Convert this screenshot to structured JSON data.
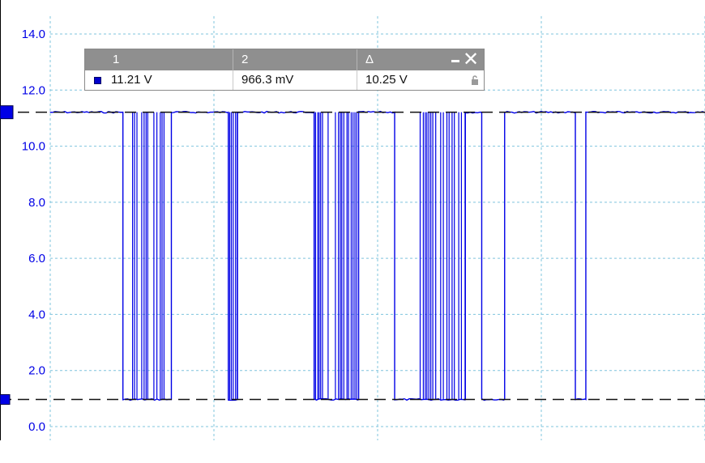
{
  "chart_data": {
    "type": "line",
    "title": "",
    "xlabel": "",
    "ylabel": "",
    "ylim": [
      0,
      14
    ],
    "y_ticks": [
      "0.0",
      "2.0",
      "4.0",
      "6.0",
      "8.0",
      "10.0",
      "12.0",
      "14.0"
    ],
    "y_tick_values": [
      0,
      2,
      4,
      6,
      8,
      10,
      12,
      14
    ],
    "grid": true,
    "series": [
      {
        "color": "#0000e6",
        "high_level": 11.21,
        "low_level": 0.966,
        "low_segments": [
          [
            0.111,
            0.185
          ],
          [
            0.272,
            0.286
          ],
          [
            0.403,
            0.471
          ],
          [
            0.526,
            0.634
          ],
          [
            0.659,
            0.694
          ],
          [
            0.802,
            0.818
          ]
        ],
        "dense_regions": [
          [
            0.122,
            0.182
          ],
          [
            0.272,
            0.286
          ],
          [
            0.403,
            0.471
          ],
          [
            0.565,
            0.634
          ]
        ]
      }
    ],
    "cursors": [
      {
        "label": "1",
        "value": 11.21
      },
      {
        "label": "2",
        "value": 0.966
      }
    ]
  },
  "colors": {
    "trace": "#0000e6",
    "tick_label": "#0000e6",
    "grid": "#7fc4de",
    "cursor_line": "#111111",
    "cursor_marker": "#0000e6"
  },
  "cursor_table": {
    "headers": [
      "1",
      "2",
      "Δ"
    ],
    "values": [
      "11.21 V",
      "966.3 mV",
      "10.25 V"
    ],
    "icons": {
      "minimize": "minimize-icon",
      "close": "close-icon",
      "lock": "lock-icon"
    }
  }
}
